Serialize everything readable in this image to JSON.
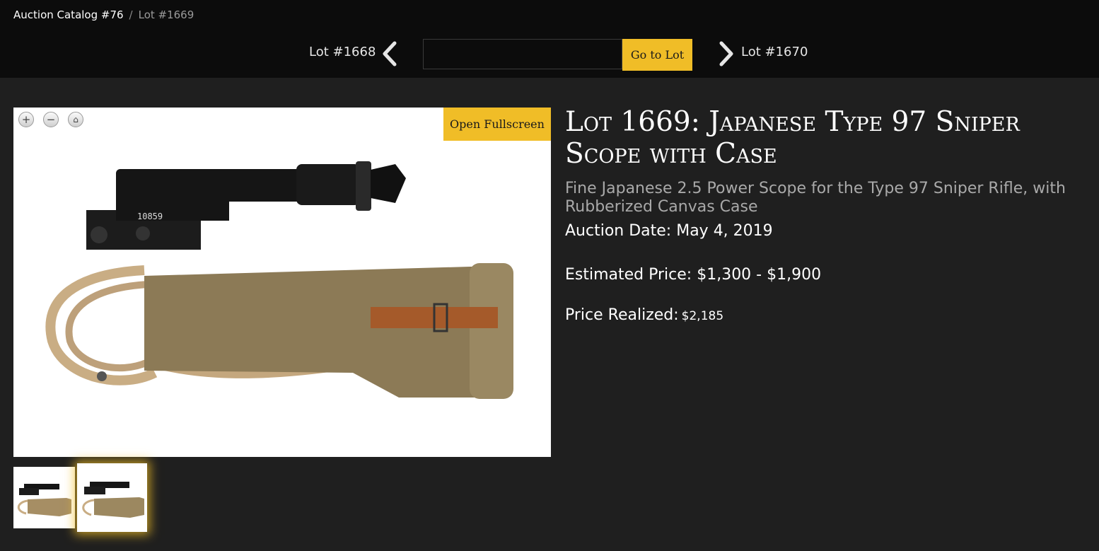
{
  "breadcrumb": {
    "catalog": "Auction Catalog #76",
    "separator": "/",
    "current": "Lot #1669"
  },
  "lot_nav": {
    "prev_label": "Lot #1668",
    "next_label": "Lot #1670",
    "input_value": "",
    "input_placeholder": "",
    "go_label": "Go to Lot"
  },
  "viewer": {
    "zoom_in": "+",
    "zoom_out": "−",
    "home": "⌂",
    "fullscreen_label": "Open Fullscreen",
    "image_text": "10859"
  },
  "lot": {
    "title": "Lot 1669: Japanese Type 97 Sniper Scope with Case",
    "subtitle": "Fine Japanese 2.5 Power Scope for the Type 97 Sniper Rifle, with Rubberized Canvas Case",
    "auction_date": "Auction Date: May 4, 2019",
    "estimate": "Estimated Price: $1,300 - $1,900",
    "realized_label": "Price Realized:",
    "realized_value": "$2,185"
  },
  "colors": {
    "accent": "#f0bd27",
    "topbar": "#0c0c0c",
    "background": "#1f1f1f"
  },
  "icons": [
    "chevron-left-icon",
    "chevron-right-icon",
    "zoom-in-icon",
    "zoom-out-icon",
    "home-icon"
  ]
}
